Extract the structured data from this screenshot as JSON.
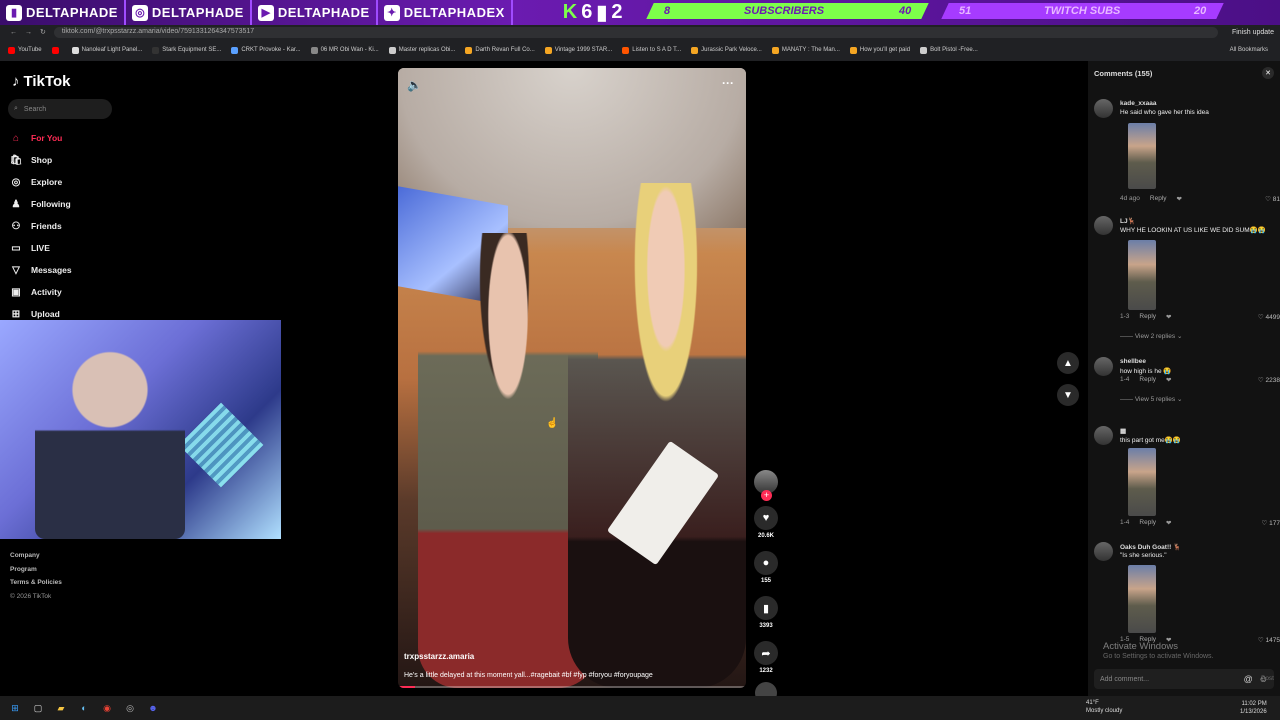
{
  "overlay": {
    "socials": [
      {
        "icon": "twitch-icon",
        "label": "DELTAPHADE"
      },
      {
        "icon": "instagram-icon",
        "label": "DELTAPHADE"
      },
      {
        "icon": "youtube-icon",
        "label": "DELTAPHADE"
      },
      {
        "icon": "twitter-icon",
        "label": "DELTAPHADEX"
      }
    ],
    "k_label": "K",
    "k_count": "6",
    "kick_count": "2",
    "subscribers": {
      "current": "8",
      "label": "SUBSCRIBERS",
      "goal": "40"
    },
    "twitch_subs": {
      "current": "51",
      "label": "TWITCH SUBS",
      "goal": "20"
    }
  },
  "browser": {
    "url": "tiktok.com/@trxpsstarzz.amaria/video/7591331264347573517",
    "finish_update": "Finish update",
    "bookmarks": [
      {
        "label": "YouTube",
        "color": "#ff0000"
      },
      {
        "label": "",
        "color": "#ff0000"
      },
      {
        "label": "Nanoleaf Light Panel...",
        "color": "#ddd"
      },
      {
        "label": "Stark Equipment SE...",
        "color": "#333"
      },
      {
        "label": "CRKT Provoke - Kar...",
        "color": "#5aa0ff"
      },
      {
        "label": "06 MR Obi Wan - Ki...",
        "color": "#888"
      },
      {
        "label": "Master replicas Obi...",
        "color": "#ccc"
      },
      {
        "label": "Darth Revan Full Co...",
        "color": "#f5a623"
      },
      {
        "label": "Vintage 1999 STAR...",
        "color": "#f5a623"
      },
      {
        "label": "Listen to S A D T...",
        "color": "#ff5500"
      },
      {
        "label": "Jurassic Park Veloce...",
        "color": "#f5a623"
      },
      {
        "label": "MANATY : The Man...",
        "color": "#f5a623"
      },
      {
        "label": "How you'll get paid",
        "color": "#f5a623"
      },
      {
        "label": "Bolt Pistol -Free...",
        "color": "#ccc"
      }
    ],
    "all_bookmarks": "All Bookmarks"
  },
  "sidebar": {
    "logo": "TikTok",
    "search_placeholder": "Search",
    "items": [
      {
        "label": "For You",
        "icon": "home-icon",
        "glyph": "⌂"
      },
      {
        "label": "Shop",
        "icon": "shop-icon",
        "glyph": "🛍"
      },
      {
        "label": "Explore",
        "icon": "compass-icon",
        "glyph": "◎"
      },
      {
        "label": "Following",
        "icon": "following-icon",
        "glyph": "♟"
      },
      {
        "label": "Friends",
        "icon": "friends-icon",
        "glyph": "⚇"
      },
      {
        "label": "LIVE",
        "icon": "live-icon",
        "glyph": "▭"
      },
      {
        "label": "Messages",
        "icon": "messages-icon",
        "glyph": "▽"
      },
      {
        "label": "Activity",
        "icon": "activity-icon",
        "glyph": "▣"
      },
      {
        "label": "Upload",
        "icon": "upload-icon",
        "glyph": "⊞"
      }
    ],
    "footer": {
      "company": "Company",
      "program": "Program",
      "terms": "Terms & Policies",
      "copyright": "© 2026 TikTok"
    }
  },
  "video": {
    "author": "trxpsstarzz.amaria",
    "caption": "He's a little delayed at this moment yall...#ragebait #bf #fyp #foryou #foryoupage",
    "likes": "20.6K",
    "comments": "155",
    "saves": "3393",
    "shares": "1232",
    "progress": 0.05
  },
  "comments": {
    "header": "Comments (155)",
    "items": [
      {
        "user": "kade_xxaaa",
        "text": "He said who gave her this idea",
        "time": "4d ago",
        "reply": "Reply",
        "likes": "81",
        "replies": ""
      },
      {
        "user": "LJ🦌",
        "text": "WHY HE LOOKIN AT US LIKE WE DID SUM😭😭",
        "time": "1-3",
        "reply": "Reply",
        "likes": "4499",
        "replies": "View 2 replies"
      },
      {
        "user": "shellbee",
        "text": "how high is he 😭",
        "time": "1-4",
        "reply": "Reply",
        "likes": "2238",
        "replies": "View 5 replies"
      },
      {
        "user": "▦",
        "text": "this part got me😭😭",
        "time": "1-4",
        "reply": "Reply",
        "likes": "177",
        "replies": ""
      },
      {
        "user": "Oaks Duh Goat!! 🦌",
        "text": "\"Is she serious.\"",
        "time": "1-5",
        "reply": "Reply",
        "likes": "1475",
        "replies": ""
      }
    ],
    "input_placeholder": "Add comment...",
    "post": "Post"
  },
  "windows": {
    "activate": "Activate Windows",
    "activate_sub": "Go to Settings to activate Windows."
  },
  "taskbar": {
    "temp": "41°F",
    "weather": "Mostly cloudy",
    "time": "11:02 PM",
    "date": "1/13/2026"
  }
}
